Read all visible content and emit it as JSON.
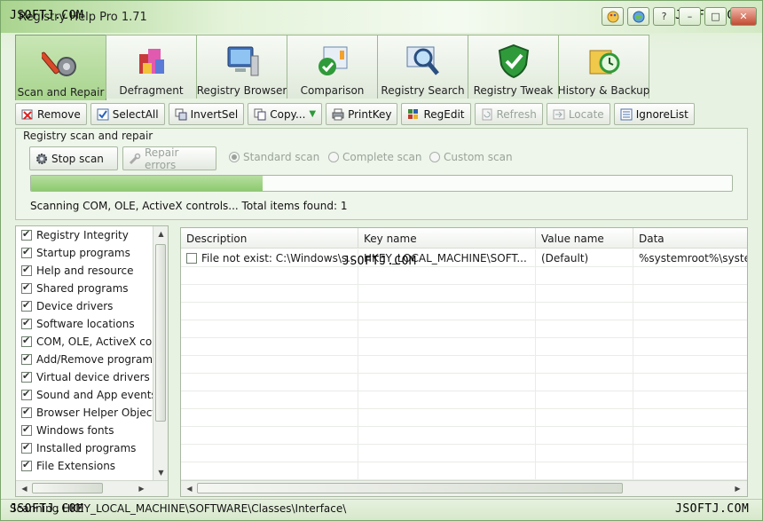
{
  "window": {
    "title": "Registry Help Pro  1.71",
    "watermark": "JSOFTJ.COM",
    "controls": {
      "help": "?",
      "minimize": "–",
      "maximize": "□",
      "close": "✕"
    }
  },
  "tabs": [
    {
      "label": "Scan and Repair",
      "icon": "wrench-gear-icon",
      "active": true
    },
    {
      "label": "Defragment",
      "icon": "defrag-blocks-icon"
    },
    {
      "label": "Registry Browser",
      "icon": "monitor-computer-icon"
    },
    {
      "label": "Comparison",
      "icon": "checkmark-window-icon"
    },
    {
      "label": "Registry Search",
      "icon": "magnifier-icon"
    },
    {
      "label": "Registry Tweak",
      "icon": "shield-check-icon"
    },
    {
      "label": "History & Backup",
      "icon": "folder-clock-icon"
    }
  ],
  "toolbar": {
    "remove": "Remove",
    "select_all": "SelectAll",
    "invert_sel": "InvertSel",
    "copy": "Copy...",
    "print_key": "PrintKey",
    "reg_edit": "RegEdit",
    "refresh": "Refresh",
    "locate": "Locate",
    "ignore_list": "IgnoreList"
  },
  "scan": {
    "group_title": "Registry scan and repair",
    "stop_scan": "Stop scan",
    "repair_errors": "Repair errors",
    "modes": [
      "Standard scan",
      "Complete scan",
      "Custom scan"
    ],
    "selected_mode": "Standard scan",
    "progress": 0.33,
    "status": "Scanning COM, OLE, ActiveX controls...   Total items found: 1"
  },
  "categories": [
    "Registry Integrity",
    "Startup programs",
    "Help and resource",
    "Shared programs",
    "Device drivers",
    "Software locations",
    "COM, OLE, ActiveX cor",
    "Add/Remove programs",
    "Virtual device drivers",
    "Sound and App events",
    "Browser Helper Object",
    "Windows fonts",
    "Installed programs",
    "File Extensions"
  ],
  "results": {
    "columns": [
      "Description",
      "Key name",
      "Value name",
      "Data"
    ],
    "rows": [
      [
        "File not exist: C:\\Windows\\s...",
        "HKEY_LOCAL_MACHINE\\SOFT...",
        "(Default)",
        "%systemroot%\\syste"
      ]
    ]
  },
  "statusbar": {
    "text": "Scanning HKEY_LOCAL_MACHINE\\SOFTWARE\\Classes\\Interface\\"
  },
  "colors": {
    "accent": "#8ccb6d",
    "active_tab": "#a8d48e",
    "frame": "#7aa56a"
  }
}
